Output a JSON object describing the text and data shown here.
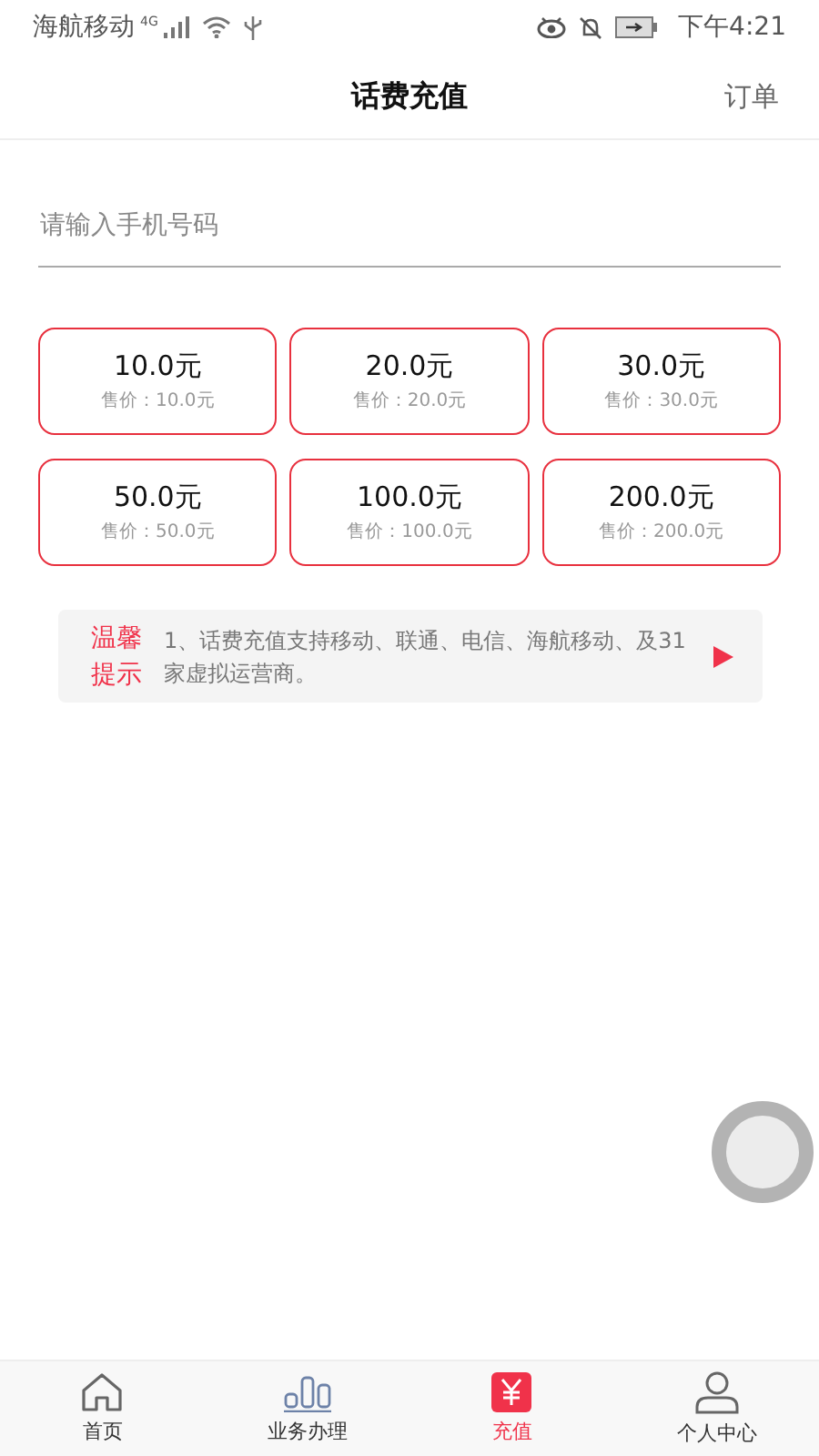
{
  "status_bar": {
    "carrier": "海航移动",
    "network": "4G",
    "time": "下午4:21"
  },
  "header": {
    "title": "话费充值",
    "action": "订单"
  },
  "phone_field": {
    "placeholder": "请输入手机号码"
  },
  "amounts": [
    {
      "amount": "10.0元",
      "price": "售价：10.0元",
      "selected": false
    },
    {
      "amount": "20.0元",
      "price": "售价：20.0元",
      "selected": false
    },
    {
      "amount": "30.0元",
      "price": "售价：30.0元",
      "selected": false
    },
    {
      "amount": "50.0元",
      "price": "售价：50.0元",
      "selected": false
    },
    {
      "amount": "100.0元",
      "price": "售价：100.0元",
      "selected": false
    },
    {
      "amount": "200.0元",
      "price": "售价：200.0元",
      "selected": false
    }
  ],
  "tip": {
    "label_line_1": "温馨",
    "label_line_2": "提示",
    "text": "1、话费充值支持移动、联通、电信、海航移动、及31家虚拟运营商。"
  },
  "tab_bar": [
    {
      "kind": "home",
      "label": "首页",
      "selected": false
    },
    {
      "kind": "business",
      "label": "业务办理",
      "selected": false
    },
    {
      "kind": "recharge",
      "label": "充值",
      "selected": true
    },
    {
      "kind": "profile",
      "label": "个人中心",
      "selected": false
    }
  ]
}
